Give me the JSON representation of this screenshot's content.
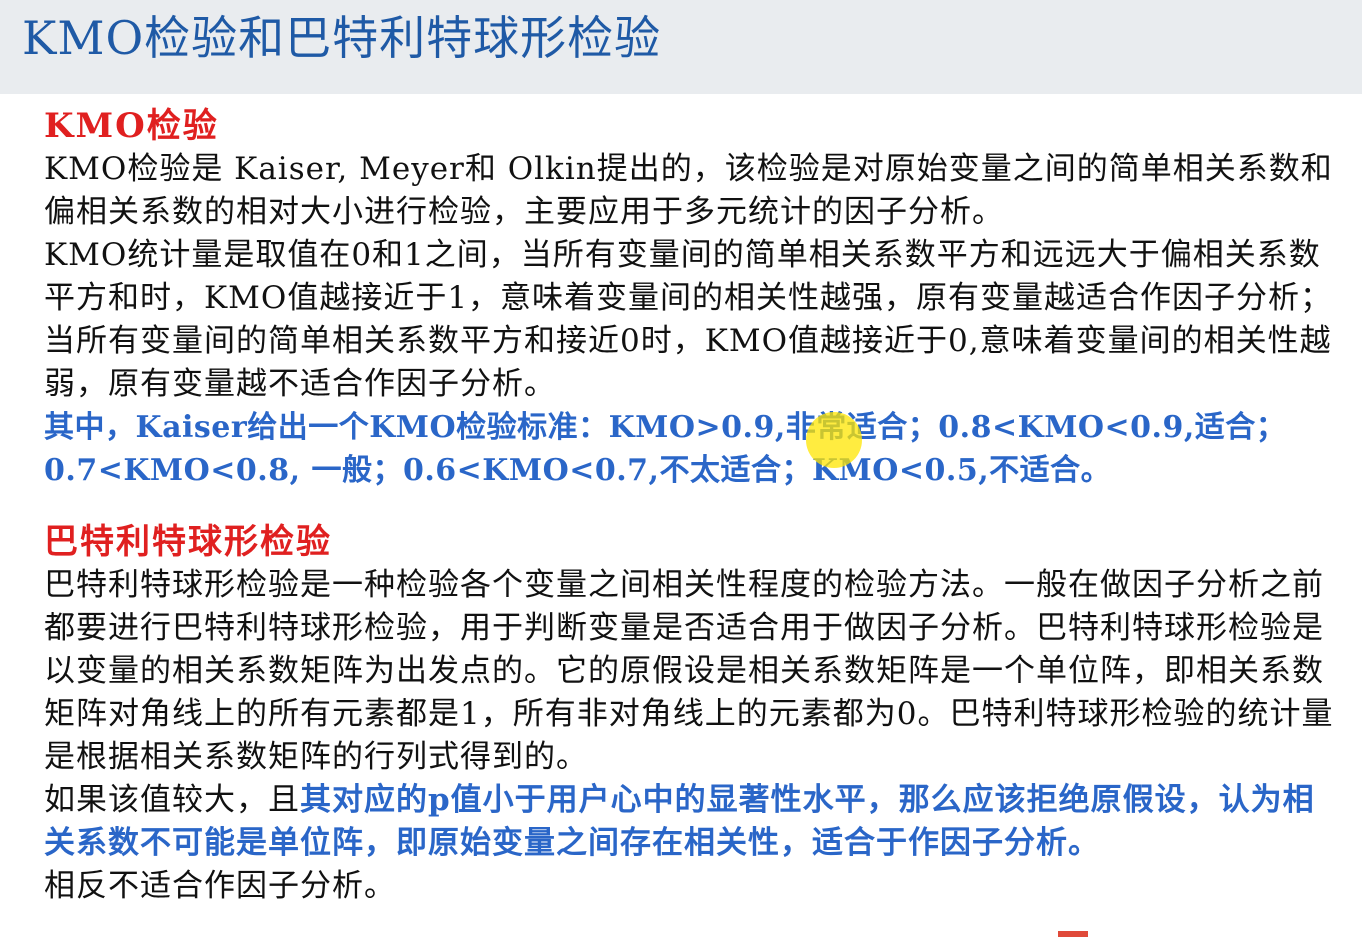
{
  "title": "KMO检验和巴特利特球形检验",
  "kmo": {
    "heading": "KMO检验",
    "p1": "KMO检验是 Kaiser, Meyer和 Olkin提出的，该检验是对原始变量之间的简单相关系数和偏相关系数的相对大小进行检验，主要应用于多元统计的因子分析。",
    "p2": "KMO统计量是取值在0和1之间，当所有变量间的简单相关系数平方和远远大于偏相关系数平方和时，KMO值越接近于1，意味着变量间的相关性越强，原有变量越适合作因子分析；当所有变量间的简单相关系数平方和接近0时，KMO值越接近于0,意味着变量间的相关性越弱，原有变量越不适合作因子分析。",
    "standard": "其中，Kaiser给出一个KMO检验标准：KMO>0.9,非常适合；0.8<KMO<0.9,适合；0.7<KMO<0.8, 一般；0.6<KMO<0.7,不太适合；KMO<0.5,不适合。"
  },
  "bartlett": {
    "heading": "巴特利特球形检验",
    "p1": "巴特利特球形检验是一种检验各个变量之间相关性程度的检验方法。一般在做因子分析之前都要进行巴特利特球形检验，用于判断变量是否适合用于做因子分析。巴特利特球形检验是以变量的相关系数矩阵为出发点的。它的原假设是相关系数矩阵是一个单位阵，即相关系数矩阵对角线上的所有元素都是1，所有非对角线上的元素都为0。巴特利特球形检验的统计量是根据相关系数矩阵的行列式得到的。",
    "p2_lead": "如果该值较大，且",
    "p2_emph": "其对应的p值小于用户心中的显著性水平，那么应该拒绝原假设，认为相关系数不可能是单位阵，即原始变量之间存在相关性，适合于作因子分析。",
    "p2_tail": "相反不适合作因子分析。"
  },
  "colors": {
    "title": "#1f5aa6",
    "heading": "#e02020",
    "emphasis": "#2a66c8",
    "title_bar": "#e9ecef",
    "cursor_highlight": "#ffe600"
  }
}
